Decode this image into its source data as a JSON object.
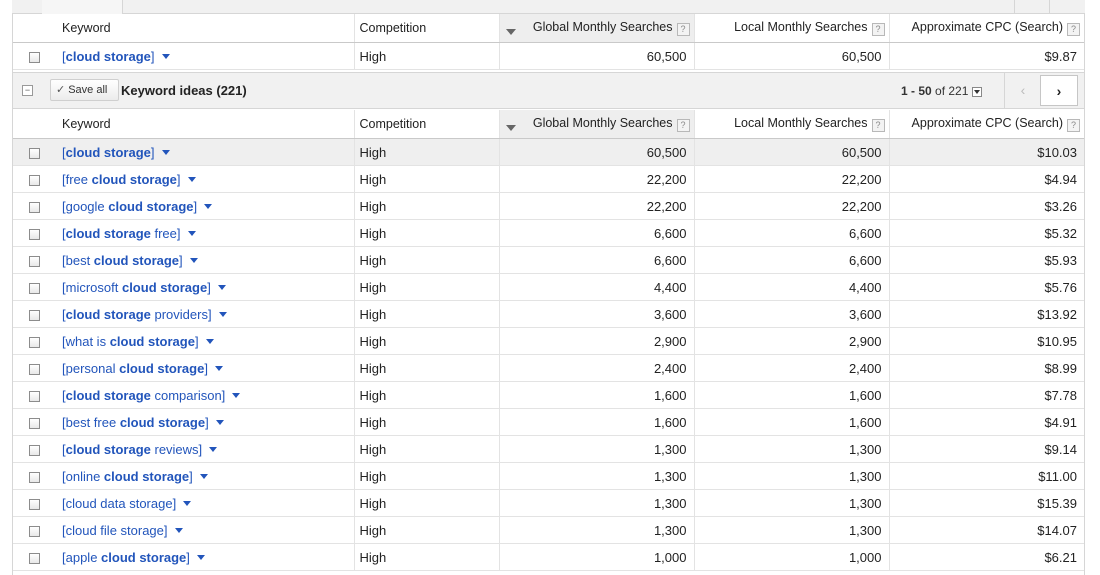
{
  "columns": {
    "keyword": "Keyword",
    "competition": "Competition",
    "global": "Global Monthly Searches",
    "local": "Local Monthly Searches",
    "cpc": "Approximate CPC (Search)",
    "help": "?"
  },
  "search_terms": {
    "row": {
      "prefix": "[",
      "bold": "cloud storage",
      "suffix": "]",
      "competition": "High",
      "global": "60,500",
      "local": "60,500",
      "cpc": "$9.87"
    }
  },
  "ideas_bar": {
    "collapse": "−",
    "save_all": "Save all",
    "title": "Keyword ideas (221)",
    "pager_range": "1 - 50",
    "pager_of": "of 221",
    "prev": "‹",
    "next": "›"
  },
  "ideas": [
    {
      "prefix": "[",
      "bold": "cloud storage",
      "suffix": "]",
      "competition": "High",
      "global": "60,500",
      "local": "60,500",
      "cpc": "$10.03"
    },
    {
      "prefix": "[free ",
      "bold": "cloud storage",
      "suffix": "]",
      "competition": "High",
      "global": "22,200",
      "local": "22,200",
      "cpc": "$4.94"
    },
    {
      "prefix": "[google ",
      "bold": "cloud storage",
      "suffix": "]",
      "competition": "High",
      "global": "22,200",
      "local": "22,200",
      "cpc": "$3.26"
    },
    {
      "prefix": "[",
      "bold": "cloud storage",
      "suffix": " free]",
      "competition": "High",
      "global": "6,600",
      "local": "6,600",
      "cpc": "$5.32"
    },
    {
      "prefix": "[best ",
      "bold": "cloud storage",
      "suffix": "]",
      "competition": "High",
      "global": "6,600",
      "local": "6,600",
      "cpc": "$5.93"
    },
    {
      "prefix": "[microsoft ",
      "bold": "cloud storage",
      "suffix": "]",
      "competition": "High",
      "global": "4,400",
      "local": "4,400",
      "cpc": "$5.76"
    },
    {
      "prefix": "[",
      "bold": "cloud storage",
      "suffix": " providers]",
      "competition": "High",
      "global": "3,600",
      "local": "3,600",
      "cpc": "$13.92"
    },
    {
      "prefix": "[what is ",
      "bold": "cloud storage",
      "suffix": "]",
      "competition": "High",
      "global": "2,900",
      "local": "2,900",
      "cpc": "$10.95"
    },
    {
      "prefix": "[personal ",
      "bold": "cloud storage",
      "suffix": "]",
      "competition": "High",
      "global": "2,400",
      "local": "2,400",
      "cpc": "$8.99"
    },
    {
      "prefix": "[",
      "bold": "cloud storage",
      "suffix": " comparison]",
      "competition": "High",
      "global": "1,600",
      "local": "1,600",
      "cpc": "$7.78"
    },
    {
      "prefix": "[best free ",
      "bold": "cloud storage",
      "suffix": "]",
      "competition": "High",
      "global": "1,600",
      "local": "1,600",
      "cpc": "$4.91"
    },
    {
      "prefix": "[",
      "bold": "cloud storage",
      "suffix": " reviews]",
      "competition": "High",
      "global": "1,300",
      "local": "1,300",
      "cpc": "$9.14"
    },
    {
      "prefix": "[online ",
      "bold": "cloud storage",
      "suffix": "]",
      "competition": "High",
      "global": "1,300",
      "local": "1,300",
      "cpc": "$11.00"
    },
    {
      "prefix": "[cloud data storage]",
      "bold": "",
      "suffix": "",
      "competition": "High",
      "global": "1,300",
      "local": "1,300",
      "cpc": "$15.39"
    },
    {
      "prefix": "[cloud file storage]",
      "bold": "",
      "suffix": "",
      "competition": "High",
      "global": "1,300",
      "local": "1,300",
      "cpc": "$14.07"
    },
    {
      "prefix": "[apple ",
      "bold": "cloud storage",
      "suffix": "]",
      "competition": "High",
      "global": "1,000",
      "local": "1,000",
      "cpc": "$6.21"
    }
  ],
  "colors": {
    "link": "#2255bb",
    "highlight_row": "#efefef",
    "header_bg": "#f1f1f1"
  },
  "icons": {
    "sort": "sort-desc-icon",
    "dropdown": "caret-down-icon",
    "save": "checkmark-icon"
  }
}
